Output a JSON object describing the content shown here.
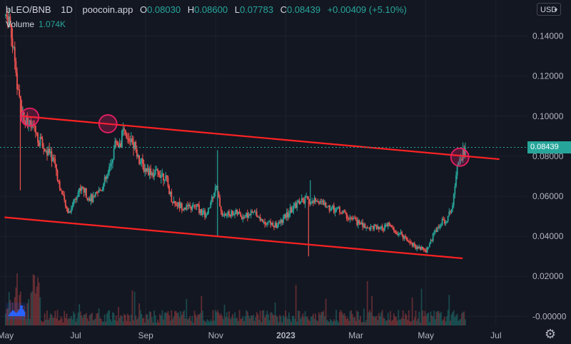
{
  "legend": {
    "symbol": "bLEO/BNB",
    "interval": "1D",
    "source": "poocoin.app",
    "open_label": "O",
    "open": "0.08030",
    "high_label": "H",
    "high": "0.08600",
    "low_label": "L",
    "low": "0.07783",
    "close_label": "C",
    "close": "0.08439",
    "change": "+0.00409 (+5.10%)",
    "volume_label": "Volume",
    "volume": "1.074K"
  },
  "currency": "USD",
  "last_price_tag": "0.08439",
  "colors": {
    "background": "#131722",
    "up": "#26a69a",
    "down": "#ef5350",
    "trendline": "#ff2222",
    "marker": "#e91e63"
  },
  "chart_data": {
    "type": "candlestick",
    "y_ticks": [
      "0.14000",
      "0.12000",
      "0.10000",
      "0.08000",
      "0.06000",
      "0.04000",
      "0.02000",
      "-0.00000"
    ],
    "y_tick_values": [
      0.14,
      0.12,
      0.1,
      0.08,
      0.06,
      0.04,
      0.02,
      0.0
    ],
    "ylim": [
      -0.0045,
      0.158
    ],
    "x_ticks": [
      "May",
      "Jul",
      "Sep",
      "Nov",
      "2023",
      "Mar",
      "May",
      "Jul"
    ],
    "x_tick_months": [
      0,
      2,
      4,
      6,
      8,
      10,
      12,
      14
    ],
    "xlim_months": [
      -0.16,
      14.9
    ],
    "last_price": 0.08439,
    "price_path": [
      [
        0.0,
        0.15
      ],
      [
        0.1,
        0.146
      ],
      [
        0.15,
        0.142
      ],
      [
        0.22,
        0.135
      ],
      [
        0.3,
        0.118
      ],
      [
        0.4,
        0.108
      ],
      [
        0.5,
        0.1
      ],
      [
        0.62,
        0.098
      ],
      [
        0.75,
        0.094
      ],
      [
        0.88,
        0.09
      ],
      [
        1.0,
        0.087
      ],
      [
        1.12,
        0.083
      ],
      [
        1.25,
        0.081
      ],
      [
        1.4,
        0.078
      ],
      [
        1.5,
        0.068
      ],
      [
        1.62,
        0.06
      ],
      [
        1.72,
        0.054
      ],
      [
        1.82,
        0.052
      ],
      [
        1.95,
        0.058
      ],
      [
        2.05,
        0.062
      ],
      [
        2.2,
        0.064
      ],
      [
        2.35,
        0.06
      ],
      [
        2.5,
        0.058
      ],
      [
        2.65,
        0.062
      ],
      [
        2.8,
        0.066
      ],
      [
        2.95,
        0.072
      ],
      [
        3.05,
        0.08
      ],
      [
        3.15,
        0.088
      ],
      [
        3.25,
        0.085
      ],
      [
        3.35,
        0.092
      ],
      [
        3.5,
        0.087
      ],
      [
        3.6,
        0.09
      ],
      [
        3.72,
        0.084
      ],
      [
        3.82,
        0.078
      ],
      [
        3.95,
        0.074
      ],
      [
        4.1,
        0.073
      ],
      [
        4.25,
        0.071
      ],
      [
        4.4,
        0.072
      ],
      [
        4.55,
        0.07
      ],
      [
        4.65,
        0.064
      ],
      [
        4.75,
        0.058
      ],
      [
        4.9,
        0.056
      ],
      [
        5.05,
        0.055
      ],
      [
        5.25,
        0.054
      ],
      [
        5.45,
        0.055
      ],
      [
        5.6,
        0.052
      ],
      [
        5.75,
        0.05
      ],
      [
        5.9,
        0.06
      ],
      [
        6.0,
        0.066
      ],
      [
        6.1,
        0.057
      ],
      [
        6.2,
        0.05
      ],
      [
        6.35,
        0.051
      ],
      [
        6.55,
        0.052
      ],
      [
        6.75,
        0.05
      ],
      [
        6.95,
        0.051
      ],
      [
        7.15,
        0.052
      ],
      [
        7.3,
        0.048
      ],
      [
        7.5,
        0.047
      ],
      [
        7.7,
        0.045
      ],
      [
        7.85,
        0.047
      ],
      [
        8.0,
        0.05
      ],
      [
        8.2,
        0.054
      ],
      [
        8.35,
        0.057
      ],
      [
        8.55,
        0.058
      ],
      [
        8.75,
        0.057
      ],
      [
        8.95,
        0.058
      ],
      [
        9.15,
        0.055
      ],
      [
        9.35,
        0.054
      ],
      [
        9.55,
        0.053
      ],
      [
        9.75,
        0.05
      ],
      [
        9.95,
        0.048
      ],
      [
        10.15,
        0.046
      ],
      [
        10.35,
        0.044
      ],
      [
        10.5,
        0.045
      ],
      [
        10.65,
        0.043
      ],
      [
        10.8,
        0.044
      ],
      [
        10.95,
        0.046
      ],
      [
        11.1,
        0.042
      ],
      [
        11.25,
        0.041
      ],
      [
        11.4,
        0.04
      ],
      [
        11.55,
        0.037
      ],
      [
        11.7,
        0.035
      ],
      [
        11.85,
        0.034
      ],
      [
        12.0,
        0.033
      ],
      [
        12.1,
        0.036
      ],
      [
        12.25,
        0.042
      ],
      [
        12.4,
        0.046
      ],
      [
        12.55,
        0.048
      ],
      [
        12.65,
        0.05
      ],
      [
        12.75,
        0.056
      ],
      [
        12.82,
        0.065
      ],
      [
        12.88,
        0.076
      ],
      [
        12.95,
        0.08
      ],
      [
        13.05,
        0.081
      ],
      [
        13.12,
        0.0844
      ]
    ],
    "spikes": [
      {
        "month": 0.42,
        "low": 0.063
      },
      {
        "month": 6.05,
        "high": 0.083,
        "low": 0.04
      },
      {
        "month": 8.65,
        "low": 0.03
      },
      {
        "month": 8.7,
        "high": 0.068
      }
    ],
    "trendlines": [
      {
        "from": [
          0.47,
          0.1
        ],
        "to": [
          14.1,
          0.0785
        ]
      },
      {
        "from": [
          -0.03,
          0.0495
        ],
        "to": [
          13.05,
          0.029
        ]
      }
    ],
    "markers": [
      {
        "month": 0.69,
        "value": 0.0995
      },
      {
        "month": 2.92,
        "value": 0.0962
      },
      {
        "month": 12.97,
        "value": 0.0795
      }
    ]
  }
}
